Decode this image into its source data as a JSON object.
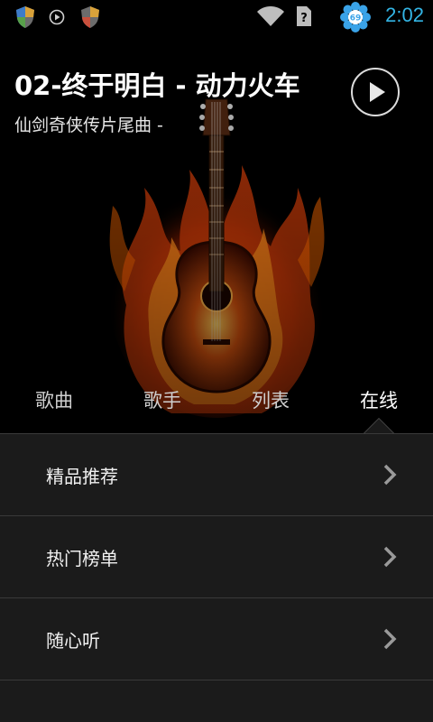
{
  "status_bar": {
    "time": "2:02",
    "notification_badge": "69",
    "icons": [
      "shield-icon",
      "play-icon",
      "shield-icon",
      "wifi-icon",
      "sim-unknown-icon",
      "flower-badge-icon"
    ]
  },
  "now_playing": {
    "title": "02-终于明白 - 动力火车",
    "subtitle": "仙剑奇侠传片尾曲 -",
    "play_icon": "play-icon"
  },
  "tabs": [
    {
      "label": "歌曲",
      "active": false
    },
    {
      "label": "歌手",
      "active": false
    },
    {
      "label": "列表",
      "active": false
    },
    {
      "label": "在线",
      "active": true
    }
  ],
  "menu": {
    "items": [
      {
        "label": "精品推荐",
        "icon": "chevron-right-icon"
      },
      {
        "label": "热门榜单",
        "icon": "chevron-right-icon"
      },
      {
        "label": "随心听",
        "icon": "chevron-right-icon"
      }
    ]
  },
  "colors": {
    "accent": "#33b5e5",
    "list_bg": "#1b1b1b",
    "divider": "#3a3a3a",
    "flame": "#ff6a00"
  }
}
